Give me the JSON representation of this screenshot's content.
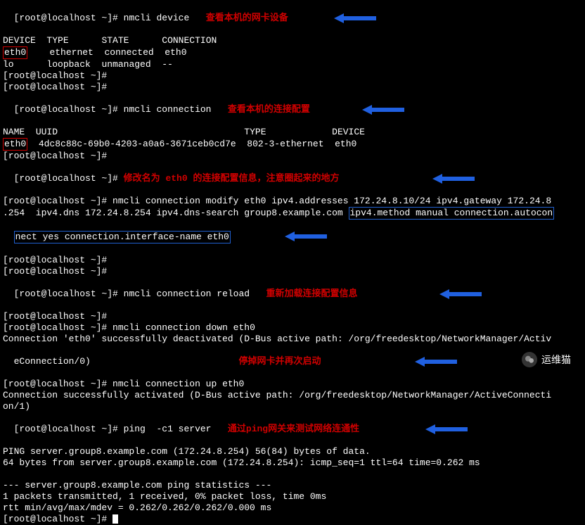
{
  "prompt": "[root@localhost ~]#",
  "cmds": {
    "device": "nmcli device",
    "connection": "nmcli connection",
    "modify1": "nmcli connection modify eth0 ipv4.addresses 172.24.8.10/24 ipv4.gateway 172.24.8",
    "modify2": ".254  ipv4.dns 172.24.8.254 ipv4.dns-search group8.example.com",
    "modify3_box": "ipv4.method manual connection.autocon",
    "modify4_box": "nect yes connection.interface-name eth0",
    "reload": "nmcli connection reload",
    "down": "nmcli connection down eth0",
    "up": "nmcli connection up eth0",
    "ping": "ping  -c1 server"
  },
  "device_table": {
    "headers": [
      "DEVICE",
      "TYPE",
      "STATE",
      "CONNECTION"
    ],
    "rows": [
      [
        "eth0",
        "ethernet",
        "connected",
        "eth0"
      ],
      [
        "lo",
        "loopback",
        "unmanaged",
        "--"
      ]
    ]
  },
  "conn_table": {
    "headers": [
      "NAME",
      "UUID",
      "TYPE",
      "DEVICE"
    ],
    "rows": [
      [
        "eth0",
        "4dc8c88c-69b0-4203-a0a6-3671ceb0cd7e",
        "802-3-ethernet",
        "eth0"
      ]
    ]
  },
  "output": {
    "down1": "Connection 'eth0' successfully deactivated (D-Bus active path: /org/freedesktop/NetworkManager/Activ",
    "down2": "eConnection/0)",
    "up1": "Connection successfully activated (D-Bus active path: /org/freedesktop/NetworkManager/ActiveConnecti",
    "up2": "on/1)",
    "ping1": "PING server.group8.example.com (172.24.8.254) 56(84) bytes of data.",
    "ping2": "64 bytes from server.group8.example.com (172.24.8.254): icmp_seq=1 ttl=64 time=0.262 ms",
    "ping3": "--- server.group8.example.com ping statistics ---",
    "ping4": "1 packets transmitted, 1 received, 0% packet loss, time 0ms",
    "ping5": "rtt min/avg/max/mdev = 0.262/0.262/0.262/0.000 ms"
  },
  "annotations": {
    "a1": "查看本机的网卡设备",
    "a2": "查看本机的连接配置",
    "a3": "修改名为 eth0 的连接配置信息，注意圈起来的地方",
    "a4": "重新加载连接配置信息",
    "a5": "停掉网卡并再次启动",
    "a6": "通过ping网关来测试网络连通性"
  },
  "watermark": "运维猫"
}
